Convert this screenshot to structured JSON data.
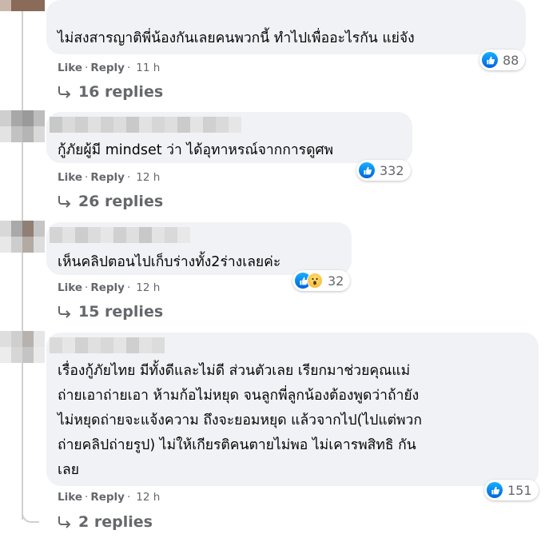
{
  "comments": [
    {
      "text_lines": [
        "ไม่สงสารญาติพี่น้องกันเลยคนพวกนี้ ทำไปเพื่ออะไรกัน แย่จัง"
      ],
      "reactions": {
        "types": [
          "like"
        ],
        "count": "88"
      },
      "actions": {
        "like": "Like",
        "reply": "Reply",
        "time": "11 h"
      },
      "replies_label": "16 replies"
    },
    {
      "text_lines": [
        "กู้ภัยผู้มี mindset ว่า ได้อุทาหรณ์จากการดูศพ"
      ],
      "reactions": {
        "types": [
          "like"
        ],
        "count": "332"
      },
      "actions": {
        "like": "Like",
        "reply": "Reply",
        "time": "12 h"
      },
      "replies_label": "26 replies"
    },
    {
      "text_lines": [
        "เห็นคลิปตอนไปเก็บร่างทั้ง2ร่างเลยค่ะ"
      ],
      "reactions": {
        "types": [
          "like",
          "wow"
        ],
        "count": "32"
      },
      "actions": {
        "like": "Like",
        "reply": "Reply",
        "time": "12 h"
      },
      "replies_label": "15 replies"
    },
    {
      "text_lines": [
        "เรื่องกู้ภัยไทย มีทั้งดีและไม่ดี ส่วนตัวเลย เรียกมาช่วยคุณแม่",
        "ถ่ายเอาถ่ายเอา ห้ามก้อไม่หยุด จนลูกพี่ลูกน้องต้องพูดว่าถ้ายัง",
        "ไม่หยุดถ่ายจะแจ้งความ ถึงจะยอมหยุด แล้วจากไป(ไปแต่พวก",
        "ถ่ายคลิปถ่ายรูป) ไม่ให้เกียรติคนตายไม่พอ ไม่เคารพสิทธิ กัน",
        "เลย"
      ],
      "reactions": {
        "types": [
          "like"
        ],
        "count": "151"
      },
      "actions": {
        "like": "Like",
        "reply": "Reply",
        "time": "12 h"
      },
      "replies_label": "2 replies"
    }
  ],
  "icons": {
    "like": "thumbs-up-icon",
    "wow": "wow-face-icon",
    "reply_arrow": "reply-arrow-icon"
  },
  "colors": {
    "bubble": "#f0f2f5",
    "meta_text": "#65676b",
    "like_blue": "#1877f2"
  }
}
